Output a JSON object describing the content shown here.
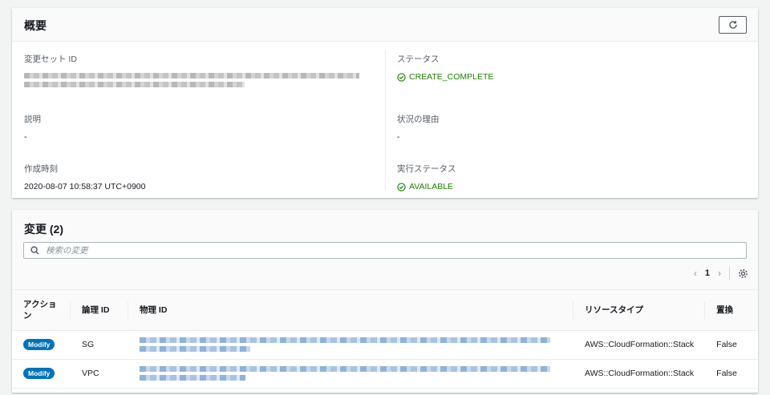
{
  "overview": {
    "title": "概要",
    "changeset_id_label": "変更セット ID",
    "status_label": "ステータス",
    "status_value": "CREATE_COMPLETE",
    "description_label": "説明",
    "description_value": "-",
    "status_reason_label": "状況の理由",
    "status_reason_value": "-",
    "created_label": "作成時刻",
    "created_value": "2020-08-07 10:58:37 UTC+0900",
    "exec_status_label": "実行ステータス",
    "exec_status_value": "AVAILABLE"
  },
  "changes": {
    "title": "変更",
    "count": "(2)",
    "search_placeholder": "検索の変更",
    "page": "1",
    "columns": [
      "アクション",
      "論理 ID",
      "物理 ID",
      "リソースタイプ",
      "置換"
    ],
    "rows": [
      {
        "action": "Modify",
        "logical_id": "SG",
        "resource_type": "AWS::CloudFormation::Stack",
        "replacement": "False"
      },
      {
        "action": "Modify",
        "logical_id": "VPC",
        "resource_type": "AWS::CloudFormation::Stack",
        "replacement": "False"
      }
    ]
  },
  "colors": {
    "success": "#1d8102",
    "link": "#0073bb",
    "border": "#eaeded"
  },
  "icons": [
    "refresh-icon",
    "check-circle-icon",
    "search-icon",
    "chevron-left-icon",
    "chevron-right-icon",
    "gear-icon"
  ]
}
